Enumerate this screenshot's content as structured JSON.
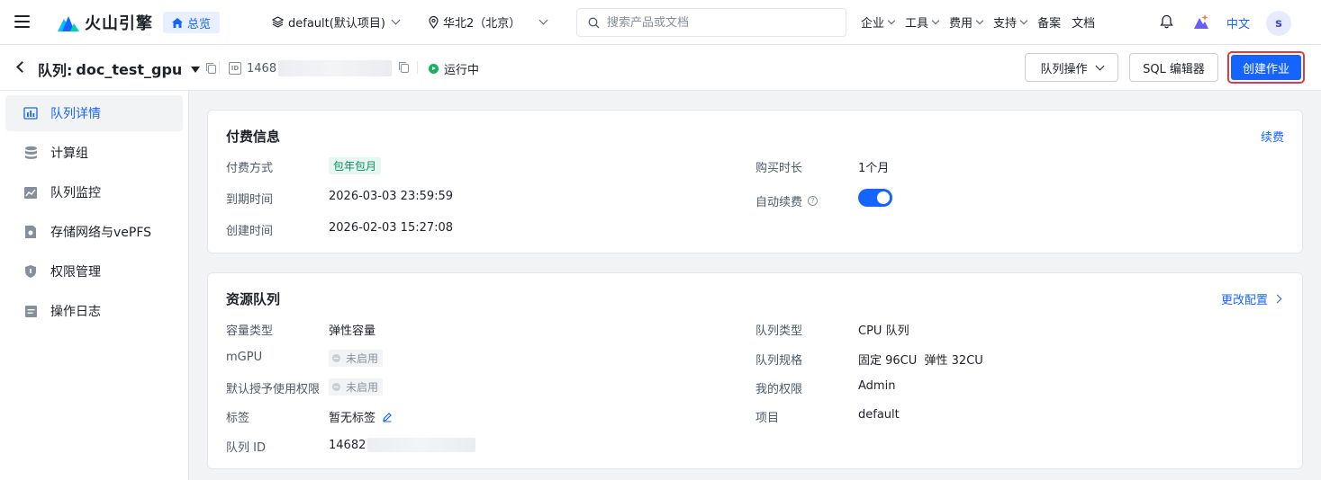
{
  "topbar": {
    "logo_text": "火山引擎",
    "home_label": "总览",
    "project_select": "default(默认项目)",
    "region_select": "华北2（北京）",
    "search_placeholder": "搜索产品或文档",
    "nav": [
      "企业",
      "工具",
      "费用",
      "支持",
      "备案",
      "文档"
    ],
    "language": "中文",
    "avatar_letter": "s"
  },
  "header": {
    "title_prefix": "队列:",
    "queue_name": "doc_test_gpu",
    "id_label": "ID",
    "id_value": "1468",
    "status": "运行中",
    "btn_queue_ops": "队列操作",
    "btn_sql_editor": "SQL 编辑器",
    "btn_create_job": "创建作业"
  },
  "sidebar": {
    "items": [
      {
        "label": "队列详情",
        "icon": "bar-chart-icon"
      },
      {
        "label": "计算组",
        "icon": "database-icon"
      },
      {
        "label": "队列监控",
        "icon": "monitor-chart-icon"
      },
      {
        "label": "存储网络与vePFS",
        "icon": "storage-icon"
      },
      {
        "label": "权限管理",
        "icon": "shield-icon"
      },
      {
        "label": "操作日志",
        "icon": "log-icon"
      }
    ]
  },
  "billing": {
    "title": "付费信息",
    "renew_link": "续费",
    "pay_method_label": "付费方式",
    "pay_method_value": "包年包月",
    "expire_label": "到期时间",
    "expire_value": "2026-03-03 23:59:59",
    "created_label": "创建时间",
    "created_value": "2026-02-03 15:27:08",
    "duration_label": "购买时长",
    "duration_value": "1个月",
    "auto_renew_label": "自动续费",
    "auto_renew_on": true
  },
  "resource": {
    "title": "资源队列",
    "change_link": "更改配置",
    "capacity_label": "容量类型",
    "capacity_value": "弹性容量",
    "mgpu_label": "mGPU",
    "mgpu_value": "未启用",
    "default_auth_label": "默认授予使用权限",
    "default_auth_value": "未启用",
    "tags_label": "标签",
    "tags_value": "暂无标签",
    "queue_id_label": "队列 ID",
    "queue_id_value": "14682",
    "queue_type_label": "队列类型",
    "queue_type_value": "CPU 队列",
    "spec_label": "队列规格",
    "spec_value": "固定 96CU  弹性 32CU",
    "my_perm_label": "我的权限",
    "my_perm_value": "Admin",
    "project_label": "项目",
    "project_value": "default"
  },
  "colors": {
    "primary": "#1664ff",
    "running": "#14b35c",
    "highlight_border": "#e23b3b"
  }
}
